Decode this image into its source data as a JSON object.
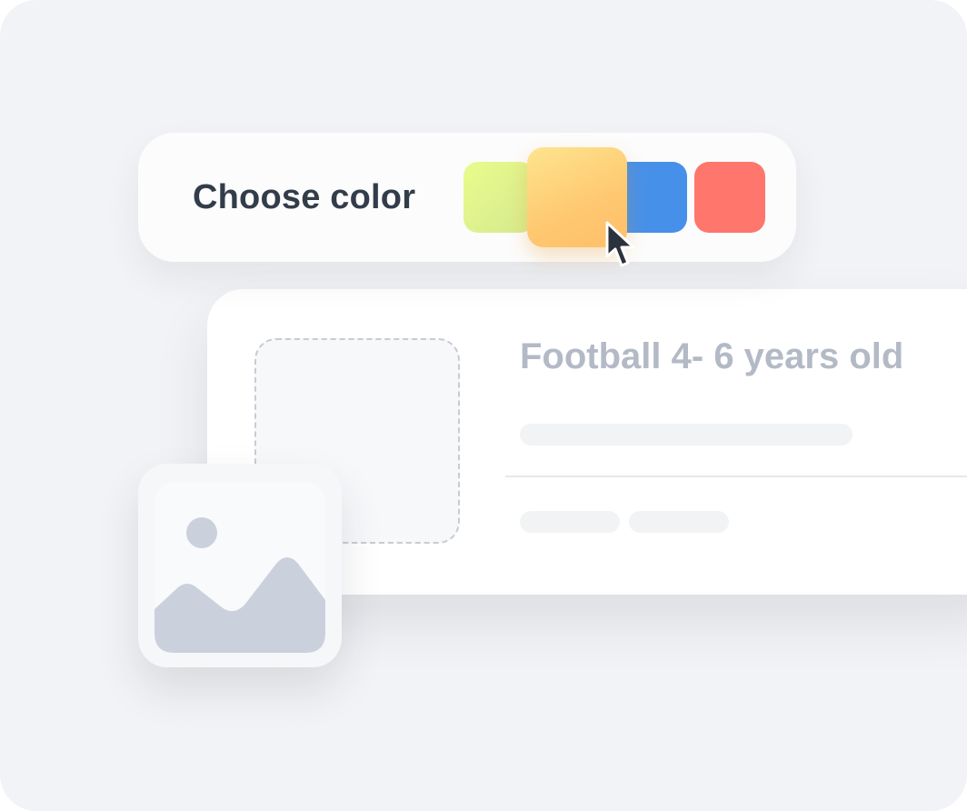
{
  "color_picker": {
    "label": "Choose color",
    "swatches": [
      {
        "name": "yellow-green",
        "color": "#E3F48C"
      },
      {
        "name": "orange",
        "color": "#FED27A",
        "selected": true
      },
      {
        "name": "blue",
        "color": "#4790EA"
      },
      {
        "name": "red",
        "color": "#FE766C"
      }
    ]
  },
  "event_card": {
    "title": "Football 4- 6 years old"
  },
  "colors": {
    "background": "#F2F3F6",
    "label_text": "#333D4A",
    "title_text": "#B3BAC6",
    "skeleton": "#F2F3F5",
    "image_icon": "#CAD1DD"
  },
  "icons": {
    "cursor": "arrow-cursor-icon",
    "image": "image-placeholder-icon"
  }
}
